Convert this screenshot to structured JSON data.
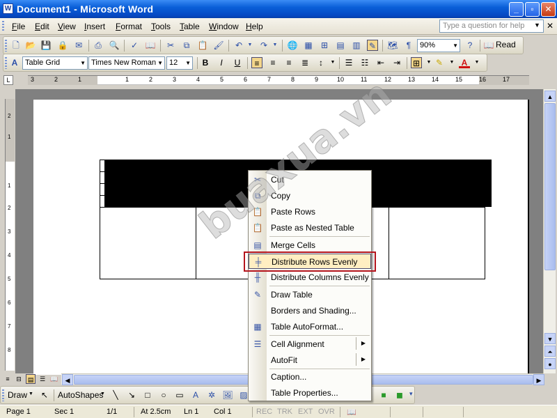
{
  "window": {
    "title": "Document1 - Microsoft Word",
    "app_icon": "W",
    "controls": [
      "_",
      "▫",
      "✕"
    ]
  },
  "menubar": {
    "items": [
      "File",
      "Edit",
      "View",
      "Insert",
      "Format",
      "Tools",
      "Table",
      "Window",
      "Help"
    ],
    "ask_placeholder": "Type a question for help",
    "close_glyph": "✕"
  },
  "standard_toolbar": {
    "zoom": "90%",
    "read_label": "Read"
  },
  "formatting_toolbar": {
    "style": "Table Grid",
    "font": "Times New Roman",
    "size": "12"
  },
  "ruler": {
    "tab_button": "L",
    "numbers": [
      "3",
      "2",
      "1",
      "1",
      "2",
      "3",
      "4",
      "5",
      "6",
      "7",
      "8",
      "9",
      "10",
      "11",
      "12",
      "13",
      "14",
      "15",
      "16",
      "17"
    ]
  },
  "context_menu": {
    "items": [
      {
        "label": "Cut",
        "icon": "scissors-icon"
      },
      {
        "label": "Copy",
        "icon": "copy-icon"
      },
      {
        "label": "Paste Rows",
        "icon": "paste-icon"
      },
      {
        "label": "Paste as Nested Table",
        "icon": "paste-nested-icon"
      },
      {
        "label": "Merge Cells",
        "icon": "merge-cells-icon"
      },
      {
        "label": "Distribute Rows Evenly",
        "icon": "distribute-rows-icon"
      },
      {
        "label": "Distribute Columns Evenly",
        "icon": "distribute-columns-icon"
      },
      {
        "label": "Draw Table",
        "icon": "pencil-icon"
      },
      {
        "label": "Borders and Shading...",
        "icon": ""
      },
      {
        "label": "Table AutoFormat...",
        "icon": "autoformat-icon"
      },
      {
        "label": "Cell Alignment",
        "icon": "cell-alignment-icon"
      },
      {
        "label": "AutoFit",
        "icon": ""
      },
      {
        "label": "Caption...",
        "icon": ""
      },
      {
        "label": "Table Properties...",
        "icon": ""
      }
    ],
    "highlighted": "Distribute Rows Evenly"
  },
  "drawing_toolbar": {
    "draw_label": "Draw",
    "autoshapes_label": "AutoShapes"
  },
  "statusbar": {
    "page": "Page 1",
    "sec": "Sec 1",
    "pages": "1/1",
    "at": "At 2.5cm",
    "ln": "Ln 1",
    "col": "Col 1",
    "rec": "REC",
    "trk": "TRK",
    "ext": "EXT",
    "ovr": "OVR"
  },
  "watermark": "buaxua.vn",
  "colors": {
    "titlebar": "#0a5fd8",
    "highlight": "#ffeec2",
    "annotation_box": "#b4141c"
  }
}
